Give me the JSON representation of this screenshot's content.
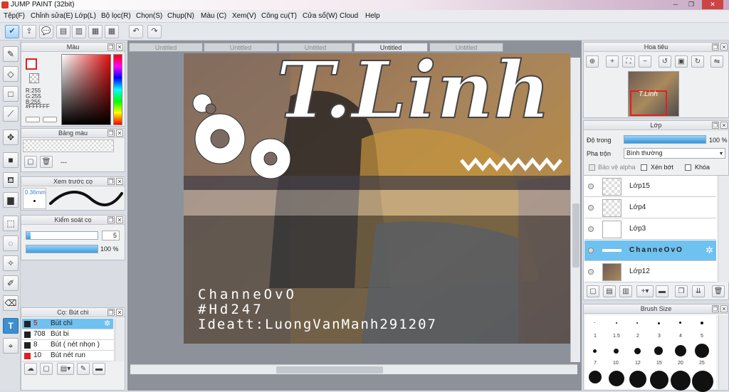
{
  "window": {
    "title": "JUMP PAINT (32bit)",
    "minimize": "─",
    "maximize": "❐",
    "close": "✕"
  },
  "menu": [
    "Tệp(F)",
    "Chỉnh sửa(E)",
    "Lớp(L)",
    "Bộ lọc(R)",
    "Chọn(S)",
    "Chụp(N)",
    "Màu (C)",
    "Xem(V)",
    "Công cụ(T)",
    "Cửa sổ(W)",
    "Cloud",
    "Help"
  ],
  "color_panel": {
    "title": "Màu",
    "r": "R:255",
    "g": "G:255",
    "b": "B:255",
    "hex": "#FFFFFF",
    "fg_color": "#ffffff",
    "fg_border": "#dd2222"
  },
  "palette_panel": {
    "title": "Bảng màu",
    "value": "---"
  },
  "brush_preview_panel": {
    "title": "Xem trước cọ",
    "size": "0.36mm"
  },
  "brush_control_panel": {
    "title": "Kiểm soát cọ",
    "size_value": "5",
    "opacity_value": "100 %"
  },
  "brush_list_panel": {
    "title": "Cọ: Bút chì",
    "items": [
      {
        "size": "5",
        "name": "Bút chì",
        "swatch": "#222222",
        "selected": true
      },
      {
        "size": "708",
        "name": "Bút bi",
        "swatch": "#222222",
        "selected": false
      },
      {
        "size": "8",
        "name": "Bút ( nét nhọn )",
        "swatch": "#222222",
        "selected": false
      },
      {
        "size": "10",
        "name": "Bút nét run",
        "swatch": "#e02020",
        "selected": false
      }
    ]
  },
  "document_tabs": [
    "Untitled",
    "Untitled",
    "Untitled",
    "Untitled",
    "Untitled"
  ],
  "active_tab_index": 3,
  "canvas": {
    "title_art": "T.Linh",
    "watermark_lines": [
      "ChanneOvO",
      "#Hd247",
      "Ideatt:LuongVanManh291207"
    ]
  },
  "navigator_panel": {
    "title": "Hoa tiêu",
    "thumb_caption": "T.Linh"
  },
  "layer_panel": {
    "title": "Lớp",
    "opacity_label": "Độ trong",
    "opacity_value": "100 %",
    "opacity_fraction": 1.0,
    "blend_label": "Pha trộn",
    "blend_value": "Bình thường",
    "protect_alpha": "Bảo vệ alpha",
    "clipping": "Xén bớt",
    "lock": "Khóa",
    "layers": [
      {
        "name": "Lớp15",
        "selected": false
      },
      {
        "name": "Lớp4",
        "selected": false
      },
      {
        "name": "Lớp3",
        "selected": false
      },
      {
        "name": "ChanneOvO",
        "selected": true
      },
      {
        "name": "Lớp12",
        "selected": false
      }
    ]
  },
  "brush_size_panel": {
    "title": "Brush Size",
    "labels": [
      "1",
      "1.5",
      "2",
      "3",
      "4",
      "5",
      "7",
      "10",
      "12",
      "15",
      "20",
      "25"
    ]
  }
}
